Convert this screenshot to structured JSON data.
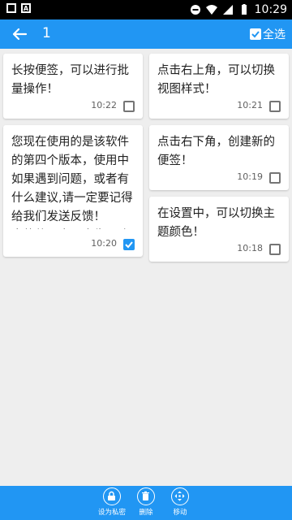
{
  "statusbar": {
    "time": "10:29"
  },
  "appbar": {
    "selected_count": "1",
    "select_all_label": "全选"
  },
  "notes": [
    {
      "text": "长按便签，可以进行批量操作！",
      "time": "10:22",
      "checked": false
    },
    {
      "text": "点击右上角，可以切换视图样式！",
      "time": "10:21",
      "checked": false
    },
    {
      "text": "您现在使用的是该软件的第四个版本，使用中如果遇到问题，或者有什么建议,请一定要记得给我们发送反馈！\n本软件无毒无广告，功能也会在后续的开发中...",
      "time": "10:20",
      "checked": true
    },
    {
      "text": "点击右下角，创建新的便签！",
      "time": "10:19",
      "checked": false
    },
    {
      "text": "在设置中，可以切换主题颜色！",
      "time": "10:18",
      "checked": false
    }
  ],
  "bottombar": {
    "private_label": "设为私密",
    "delete_label": "删除",
    "move_label": "移动"
  },
  "colors": {
    "accent": "#2196f3",
    "background": "#eeeeee",
    "statusbar": "#000000"
  }
}
